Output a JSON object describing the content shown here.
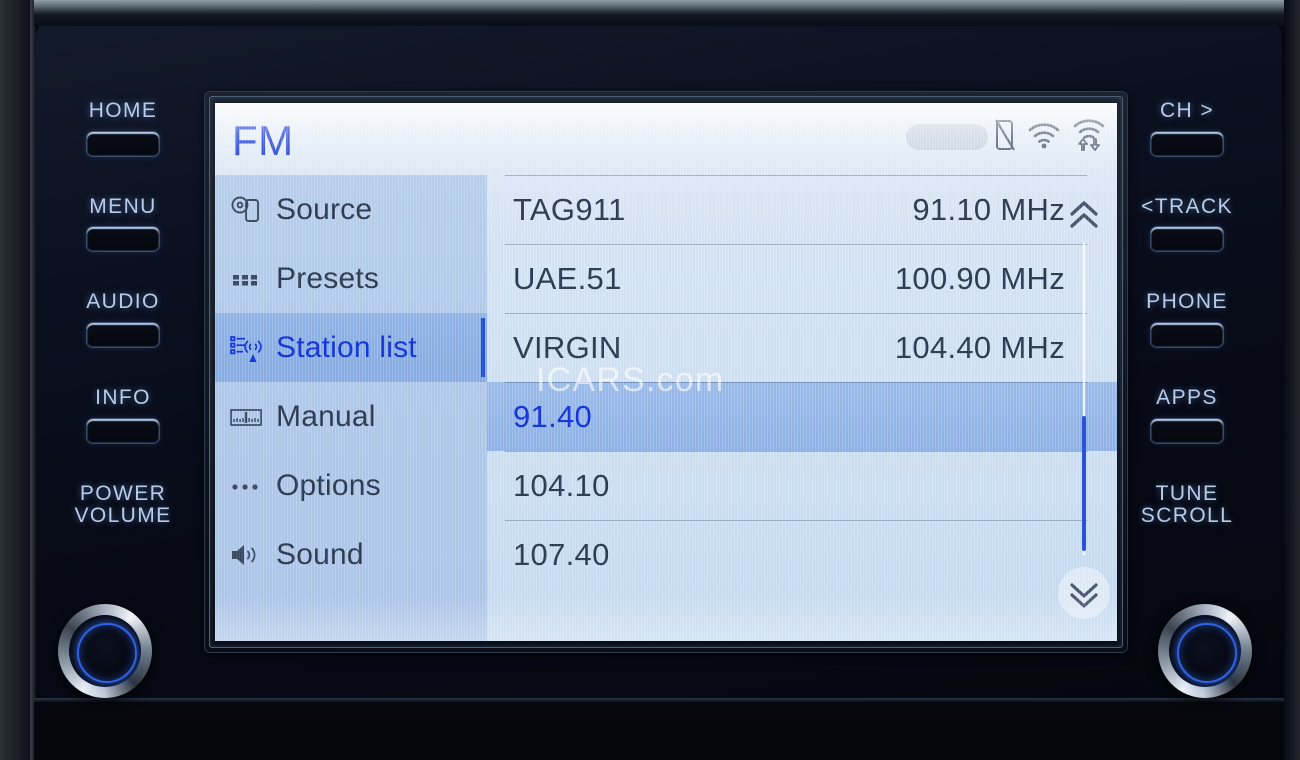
{
  "device": {
    "name": "car-infotainment-head-unit",
    "brand_accent": "#1536d8",
    "screen_bg": "#cfe0f3",
    "sidebar_bg": "#b3cbea",
    "selected_bg": "#8aafe3"
  },
  "screen": {
    "header": {
      "title": "FM",
      "status_icons": [
        {
          "name": "phone-disconnected-icon",
          "glyph": "no-phone"
        },
        {
          "name": "wifi-icon",
          "glyph": "wifi"
        },
        {
          "name": "wifi-data-transfer-icon",
          "glyph": "wifi-arrows"
        }
      ]
    },
    "sidebar": {
      "items": [
        {
          "label": "Source",
          "icon": "disc-device-icon",
          "name": "sidebar-item-source",
          "selected": false
        },
        {
          "label": "Presets",
          "icon": "grid-dots-icon",
          "name": "sidebar-item-presets",
          "selected": false
        },
        {
          "label": "Station list",
          "icon": "station-list-icon",
          "name": "sidebar-item-station-list",
          "selected": true
        },
        {
          "label": "Manual",
          "icon": "tuning-dial-icon",
          "name": "sidebar-item-manual",
          "selected": false
        },
        {
          "label": "Options",
          "icon": "ellipsis-icon",
          "name": "sidebar-item-options",
          "selected": false
        },
        {
          "label": "Sound",
          "icon": "speaker-icon",
          "name": "sidebar-item-sound",
          "selected": false
        }
      ]
    },
    "station_list": {
      "rows": [
        {
          "name": "TAG911",
          "frequency": "91.10 MHz",
          "selected": false
        },
        {
          "name": "UAE.51",
          "frequency": "100.90 MHz",
          "selected": false
        },
        {
          "name": "VIRGIN",
          "frequency": "104.40 MHz",
          "selected": false
        },
        {
          "name": "91.40",
          "frequency": "",
          "selected": true
        },
        {
          "name": "104.10",
          "frequency": "",
          "selected": false
        },
        {
          "name": "107.40",
          "frequency": "",
          "selected": false
        }
      ]
    },
    "scrollbar": {
      "up_icon": "double-chevron-up-icon",
      "down_icon": "double-chevron-down-icon",
      "thumb_position_pct": 62
    },
    "watermark": "ICARS.com"
  },
  "hard_buttons": {
    "left": [
      {
        "label": "HOME",
        "name": "home-button"
      },
      {
        "label": "MENU",
        "name": "menu-button"
      },
      {
        "label": "AUDIO",
        "name": "audio-button"
      },
      {
        "label": "INFO",
        "name": "info-button"
      }
    ],
    "left_knob": {
      "line1": "POWER",
      "line2": "VOLUME",
      "name": "power-volume-knob"
    },
    "right": [
      {
        "label": "CH >",
        "name": "channel-up-button"
      },
      {
        "label": "<TRACK",
        "name": "track-back-button"
      },
      {
        "label": "PHONE",
        "name": "phone-button"
      },
      {
        "label": "APPS",
        "name": "apps-button"
      }
    ],
    "right_knob": {
      "line1": "TUNE",
      "line2": "SCROLL",
      "name": "tune-scroll-knob"
    }
  }
}
